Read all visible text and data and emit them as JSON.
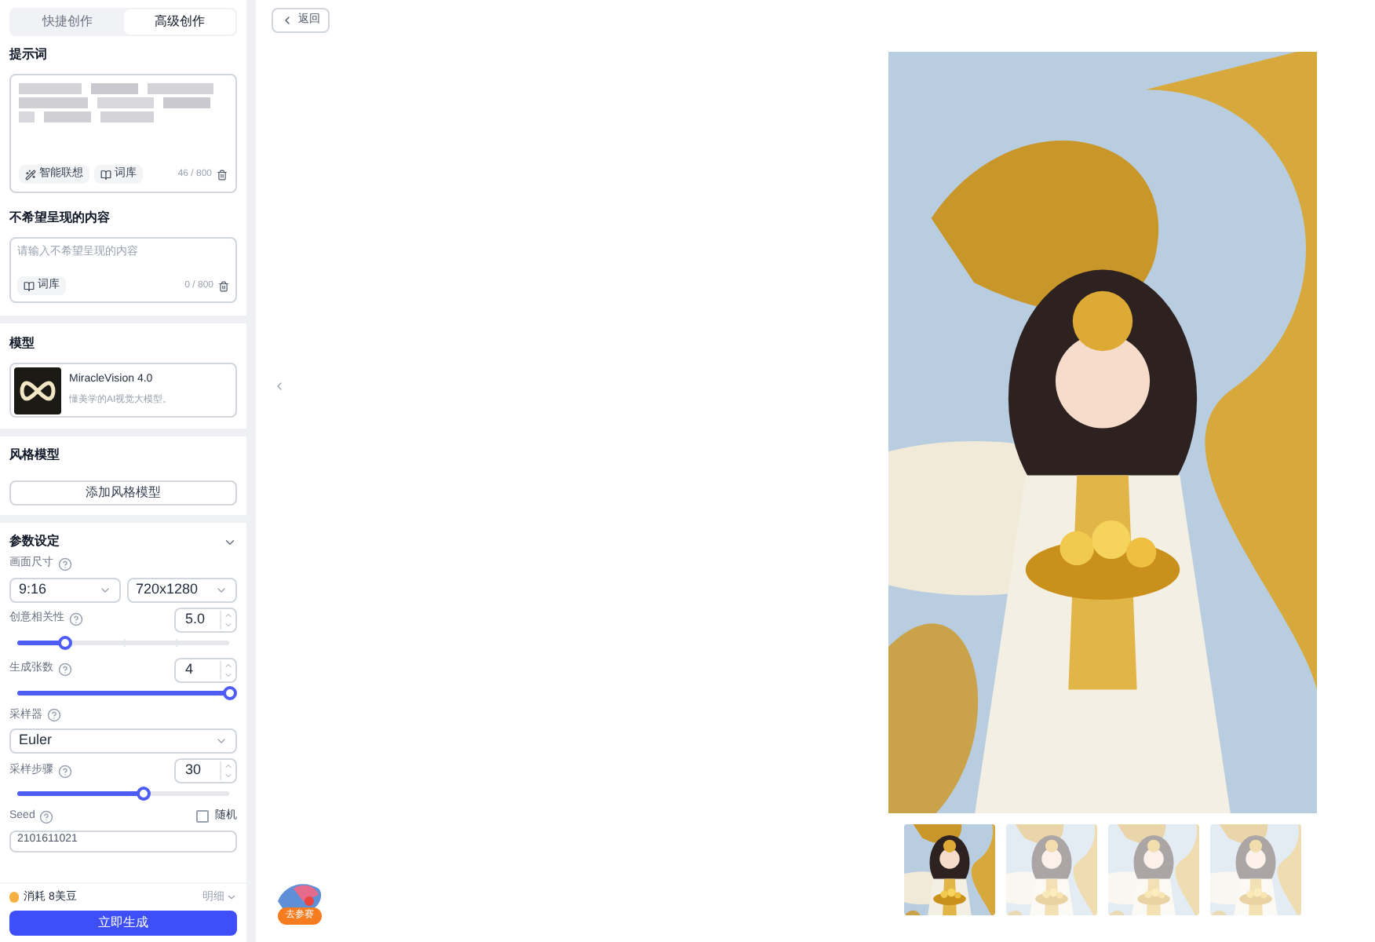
{
  "mode_tabs": [
    {
      "label": "快捷创作",
      "selected": false
    },
    {
      "label": "高级创作",
      "selected": true
    }
  ],
  "prompt": {
    "title": "提示词",
    "tools": [
      "智能联想",
      "词库"
    ],
    "count": "46 / 800"
  },
  "negative": {
    "title": "不希望呈现的内容",
    "placeholder": "请输入不希望呈现的内容",
    "tools": [
      "词库"
    ],
    "count": "0 / 800"
  },
  "model": {
    "title": "模型",
    "name": "MiracleVision 4.0",
    "desc": "懂美学的AI视觉大模型。"
  },
  "style_model": {
    "title": "风格模型",
    "button": "添加风格模型"
  },
  "params": {
    "title": "参数设定",
    "expanded": true,
    "size_label": "画面尺寸",
    "ratio": "9:16",
    "resolution": "720x1280",
    "sliders": [
      {
        "label": "创意相关性",
        "value": "5.0",
        "level": 0.22,
        "ticks": true
      },
      {
        "label": "生成张数",
        "value": "4",
        "level": 1.0,
        "ticks": false
      }
    ],
    "sampler_label": "采样器",
    "sampler": "Euler",
    "steps": {
      "label": "采样步骤",
      "value": "30",
      "level": 0.59,
      "ticks": false
    },
    "seed_label": "Seed",
    "random": {
      "label": "随机",
      "checked": false
    },
    "seed": "2101611021"
  },
  "footer": {
    "cost": "消耗 8美豆",
    "detail": "明细",
    "generate": "立即生成"
  },
  "back": "返回",
  "badge": "去参赛",
  "thumbnails": [
    {
      "selected": true
    },
    {
      "selected": false
    },
    {
      "selected": false
    },
    {
      "selected": false
    }
  ]
}
